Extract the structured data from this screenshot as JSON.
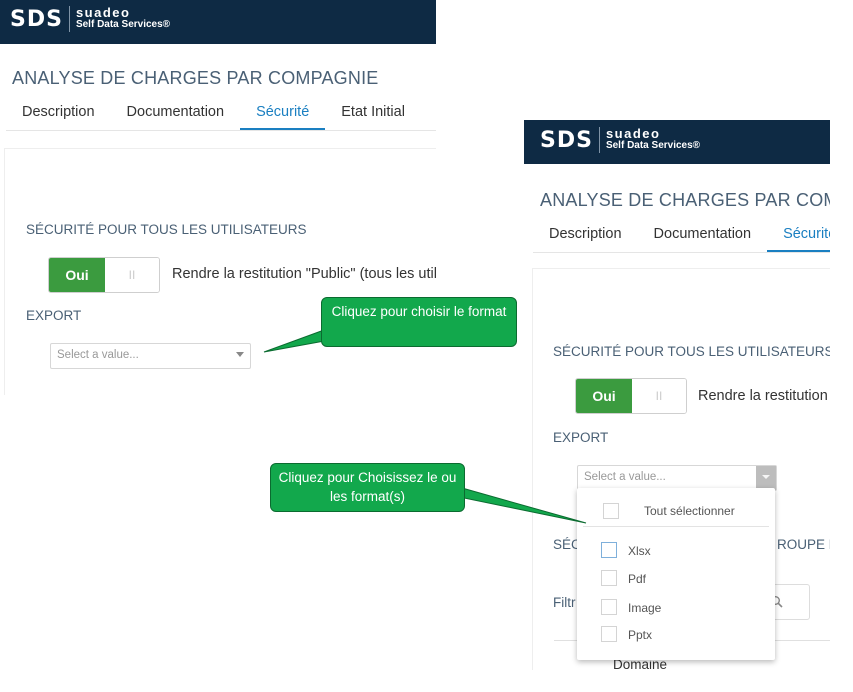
{
  "logo": {
    "mark": "SDS",
    "name": "suadeo",
    "subtitle": "Self Data Services®"
  },
  "page_title": "ANALYSE DE CHARGES PAR COMPAGNIE",
  "tabs": [
    {
      "label": "Description"
    },
    {
      "label": "Documentation"
    },
    {
      "label": "Sécurité",
      "active": true
    },
    {
      "label": "Etat Initial"
    }
  ],
  "security": {
    "section_label": "SÉCURITÉ POUR TOUS LES UTILISATEURS",
    "toggle_on_label": "Oui",
    "toggle_off_label": "II",
    "public_description": "Rendre la restitution \"Public\" (tous les utilisateurs)"
  },
  "export": {
    "label": "EXPORT",
    "placeholder": "Select a value...",
    "options": [
      {
        "label": "Xlsx",
        "checked": false
      },
      {
        "label": "Pdf",
        "checked": false
      },
      {
        "label": "Image",
        "checked": false
      },
      {
        "label": "Pptx",
        "checked": false
      }
    ],
    "select_all_label": "Tout sélectionner"
  },
  "background": {
    "group_section_partial_left": "SÉC",
    "group_section_partial_right": "ROUPE D",
    "filter_partial": "Filtr",
    "domain_column": "Domaine"
  },
  "callouts": {
    "choose_format": "Cliquez pour choisir le format",
    "choose_formats": "Cliquez pour Choisissez le ou les format(s)"
  },
  "colors": {
    "brand_bar": "#0e2a44",
    "accent": "#1a7fc1",
    "toggle_on": "#3b9b3f",
    "callout": "#12a84c"
  }
}
